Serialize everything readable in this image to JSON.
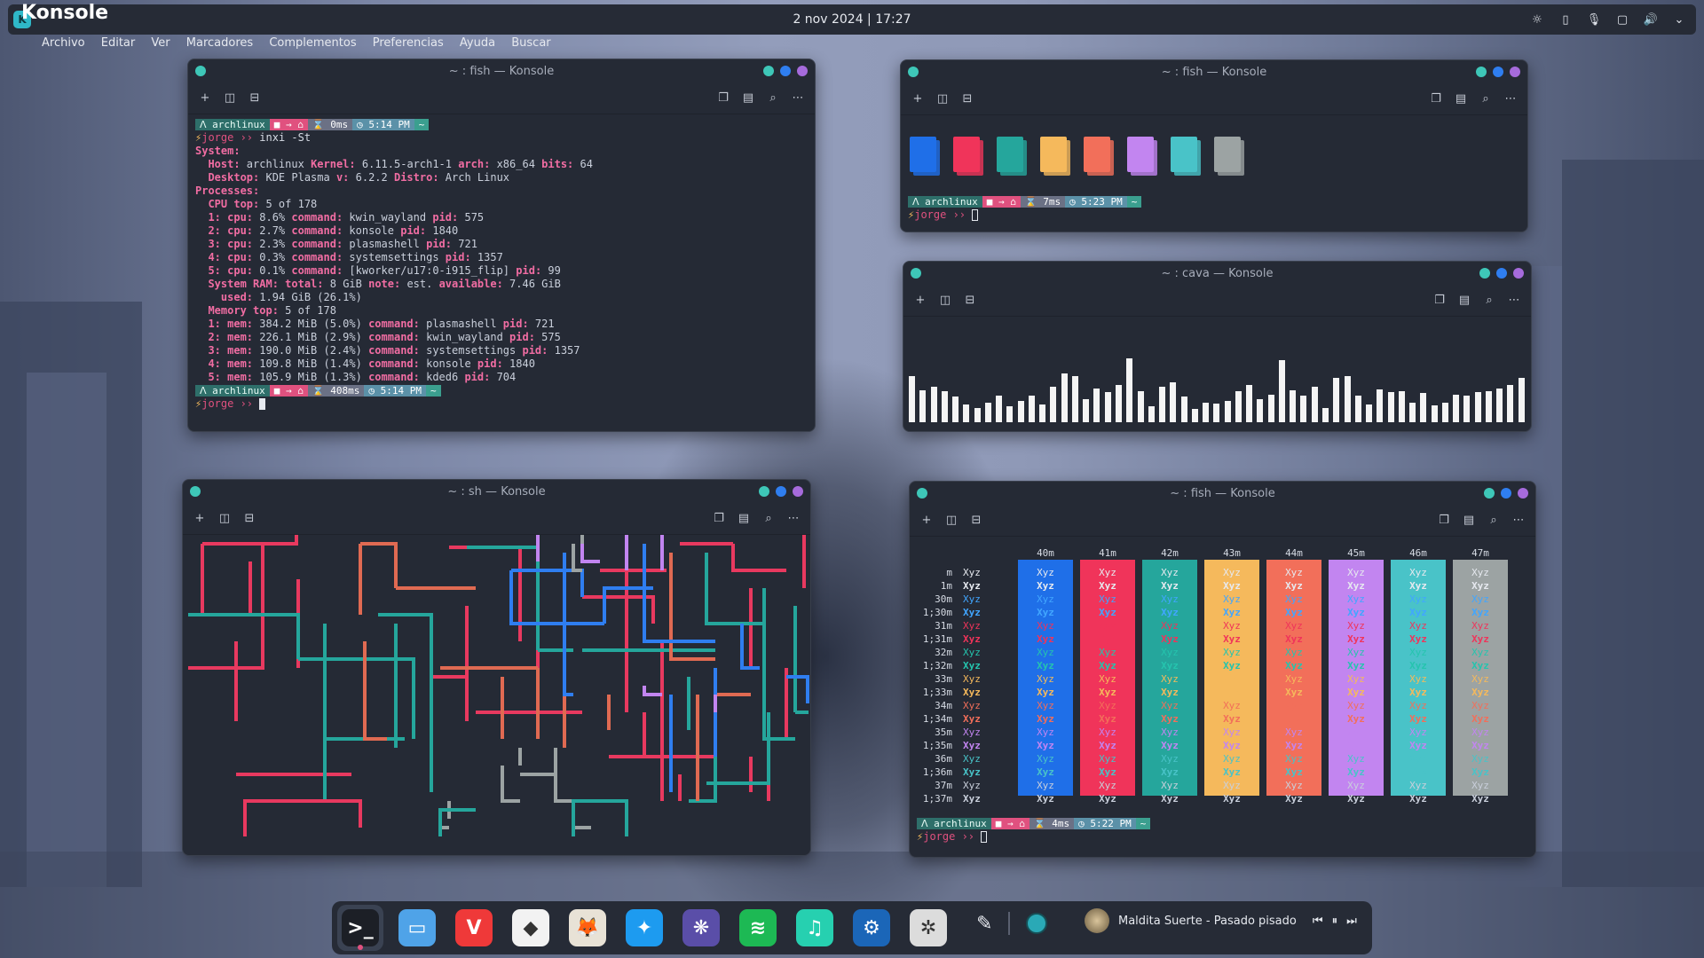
{
  "topbar": {
    "app": "Konsole",
    "menu": [
      "Archivo",
      "Editar",
      "Ver",
      "Marcadores",
      "Complementos",
      "Preferencias",
      "Ayuda",
      "Buscar"
    ],
    "clock": "2 nov 2024 | 17:27",
    "tray_icons": [
      "brightness-icon",
      "clipboard-icon",
      "microphone-icon",
      "twitch-icon",
      "volume-icon",
      "chevron-down-icon"
    ]
  },
  "windows": {
    "inxi": {
      "title": "~ : fish — Konsole",
      "prompt1": {
        "host": "archlinux",
        "time_taken": "0ms",
        "clock": "5:14 PM"
      },
      "command_user": "jorge",
      "command": "inxi -St",
      "lines": [
        [
          "System:",
          ""
        ],
        [
          "  Host:",
          " archlinux ",
          "Kernel:",
          " 6.11.5-arch1-1 ",
          "arch:",
          " x86_64 ",
          "bits:",
          " 64"
        ],
        [
          "  Desktop:",
          " KDE Plasma ",
          "v:",
          " 6.2.2 ",
          "Distro:",
          " Arch Linux"
        ],
        [
          "Processes:",
          ""
        ],
        [
          "  CPU top:",
          " 5 of 178"
        ],
        [
          "  1: cpu:",
          " 8.6% ",
          "command:",
          " kwin_wayland ",
          "pid:",
          " 575"
        ],
        [
          "  2: cpu:",
          " 2.7% ",
          "command:",
          " konsole ",
          "pid:",
          " 1840"
        ],
        [
          "  3: cpu:",
          " 2.3% ",
          "command:",
          " plasmashell ",
          "pid:",
          " 721"
        ],
        [
          "  4: cpu:",
          " 0.3% ",
          "command:",
          " systemsettings ",
          "pid:",
          " 1357"
        ],
        [
          "  5: cpu:",
          " 0.1% ",
          "command:",
          " [kworker/u17:0-i915_flip] ",
          "pid:",
          " 99"
        ],
        [
          "  System RAM:",
          " ",
          "total:",
          " 8 GiB ",
          "note:",
          " est. ",
          "available:",
          " 7.46 GiB"
        ],
        [
          "    used:",
          " 1.94 GiB (26.1%)"
        ],
        [
          "  Memory top:",
          " 5 of 178"
        ],
        [
          "  1: mem:",
          " 384.2 MiB (5.0%) ",
          "command:",
          " plasmashell ",
          "pid:",
          " 721"
        ],
        [
          "  2: mem:",
          " 226.1 MiB (2.9%) ",
          "command:",
          " kwin_wayland ",
          "pid:",
          " 575"
        ],
        [
          "  3: mem:",
          " 190.0 MiB (2.4%) ",
          "command:",
          " systemsettings ",
          "pid:",
          " 1357"
        ],
        [
          "  4: mem:",
          " 109.8 MiB (1.4%) ",
          "command:",
          " konsole ",
          "pid:",
          " 1840"
        ],
        [
          "  5: mem:",
          " 105.9 MiB (1.3%) ",
          "command:",
          " kded6 ",
          "pid:",
          " 704"
        ]
      ],
      "prompt2": {
        "host": "archlinux",
        "time_taken": "408ms",
        "clock": "5:14 PM"
      },
      "prompt_user": "jorge"
    },
    "swatches": {
      "title": "~ : fish — Konsole",
      "colors": [
        "#1f6fe8",
        "#f0345a",
        "#25a69c",
        "#f5b95c",
        "#f26f5a",
        "#c285f0",
        "#49c3c8",
        "#9ca3a3"
      ],
      "prompt": {
        "host": "archlinux",
        "time_taken": "7ms",
        "clock": "5:23 PM"
      },
      "prompt_user": "jorge"
    },
    "cava": {
      "title": "~ : cava — Konsole",
      "bars": [
        52,
        36,
        40,
        35,
        29,
        20,
        16,
        22,
        30,
        18,
        24,
        30,
        20,
        40,
        55,
        52,
        26,
        38,
        34,
        42,
        72,
        35,
        18,
        40,
        45,
        29,
        15,
        22,
        21,
        24,
        35,
        42,
        26,
        31,
        70,
        36,
        30,
        40,
        16,
        50,
        52,
        30,
        20,
        37,
        34,
        35,
        22,
        33,
        19,
        22,
        31,
        30,
        34,
        35,
        38,
        42,
        50
      ]
    },
    "palette": {
      "title": "~ : fish — Konsole",
      "columns": [
        "40m",
        "41m",
        "42m",
        "43m",
        "44m",
        "45m",
        "46m",
        "47m"
      ],
      "rows": [
        "m",
        "1m",
        "30m",
        "1;30m",
        "31m",
        "1;31m",
        "32m",
        "1;32m",
        "33m",
        "1;33m",
        "34m",
        "1;34m",
        "35m",
        "1;35m",
        "36m",
        "1;36m",
        "37m",
        "1;37m"
      ],
      "sample": "Xyz",
      "prompt": {
        "host": "archlinux",
        "time_taken": "4ms",
        "clock": "5:22 PM"
      },
      "prompt_user": "jorge"
    },
    "pipes": {
      "title": "~ : sh — Konsole"
    }
  },
  "toolbar_icons": {
    "new_tab": "+",
    "split_h": "◫",
    "split_v": "⊟",
    "copy": "❐",
    "paste": "📋",
    "find": "⌕",
    "menu": "⋯"
  },
  "prompt_glyphs": {
    "arch": "ᐱ",
    "bolt": "⚡",
    "chevrons": "››",
    "folder": "■ → ⌂",
    "timer": "⌛",
    "clock": "◷",
    "tilde": "~"
  },
  "dock": {
    "apps": [
      {
        "name": "terminal",
        "glyph": ">_",
        "color": "#1c1f26"
      },
      {
        "name": "files",
        "glyph": "▭",
        "color": "#4fa3e8"
      },
      {
        "name": "vivaldi",
        "glyph": "V",
        "color": "#ef3939"
      },
      {
        "name": "inkscape",
        "glyph": "◆",
        "color": "#f2f2f2"
      },
      {
        "name": "gimp",
        "glyph": "🦊",
        "color": "#e8e2d6"
      },
      {
        "name": "kdeconnect",
        "glyph": "✦",
        "color": "#1d9bf0"
      },
      {
        "name": "krita",
        "glyph": "❋",
        "color": "#5a4ea8"
      },
      {
        "name": "spotify",
        "glyph": "≋",
        "color": "#1db954"
      },
      {
        "name": "music",
        "glyph": "♫",
        "color": "#26d0b0"
      },
      {
        "name": "steam",
        "glyph": "⚙",
        "color": "#1b66b8"
      },
      {
        "name": "settings",
        "glyph": "✲",
        "color": "#dcdcdc"
      }
    ],
    "media_title": "Maldita Suerte - Pasado pisado",
    "media_controls": [
      "⏮",
      "⏸",
      "⏭"
    ]
  }
}
